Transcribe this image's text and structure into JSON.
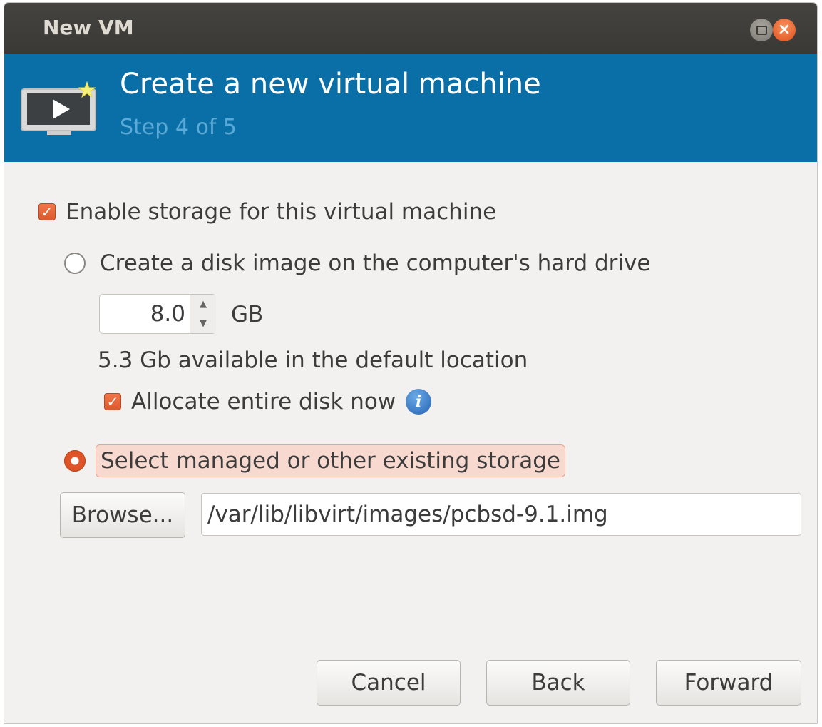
{
  "window": {
    "title": "New VM"
  },
  "header": {
    "title": "Create a new virtual machine",
    "step": "Step 4 of 5",
    "icon": "monitor-play-icon"
  },
  "storage": {
    "enable_label": "Enable storage for this virtual machine",
    "enable_checked": true,
    "create_disk_label": "Create a disk image on the computer's hard drive",
    "create_disk_selected": false,
    "size_value": "8.0",
    "size_unit": "GB",
    "available_text": "5.3 Gb available in the default location",
    "allocate_label": "Allocate entire disk now",
    "allocate_checked": true,
    "existing_label": "Select managed or other existing storage",
    "existing_selected": true,
    "browse_label": "Browse...",
    "path_value": "/var/lib/libvirt/images/pcbsd-9.1.img"
  },
  "footer": {
    "cancel_label": "Cancel",
    "back_label": "Back",
    "forward_label": "Forward"
  },
  "colors": {
    "banner": "#0a6fa6",
    "accent": "#dd5a2c",
    "titlebar": "#3e3c38"
  }
}
